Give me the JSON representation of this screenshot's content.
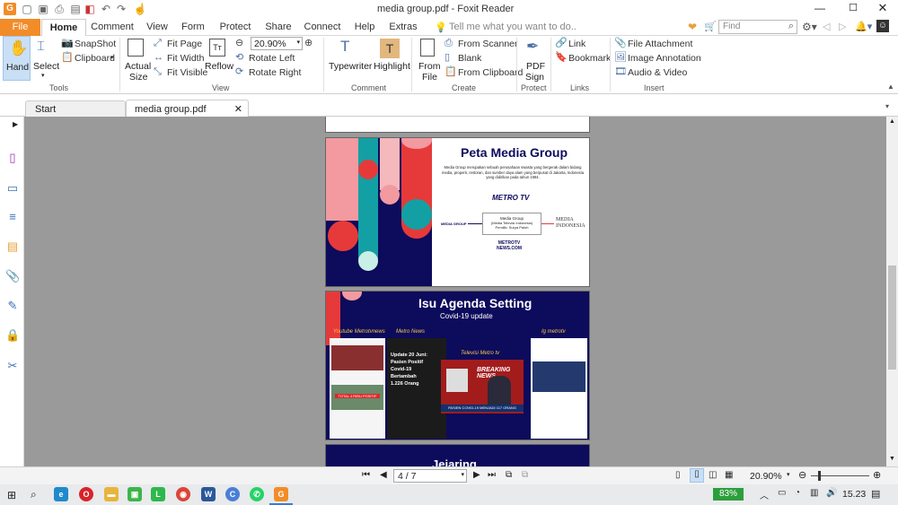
{
  "app": {
    "title": "media group.pdf - Foxit Reader",
    "find_placeholder": "Find",
    "tell_me": "Tell me what you want to do.."
  },
  "menu_tabs": [
    "File",
    "Home",
    "Comment",
    "View",
    "Form",
    "Protect",
    "Share",
    "Connect",
    "Help",
    "Extras"
  ],
  "ribbon": {
    "hand": "Hand",
    "select": "Select",
    "snapshot": "SnapShot",
    "clipboard": "Clipboard",
    "actual_size_1": "Actual",
    "actual_size_2": "Size",
    "fit_page": "Fit Page",
    "fit_width": "Fit Width",
    "fit_visible": "Fit Visible",
    "reflow": "Reflow",
    "zoom_value": "20.90%",
    "rotate_left": "Rotate Left",
    "rotate_right": "Rotate Right",
    "typewriter": "Typewriter",
    "highlight": "Highlight",
    "from_file_1": "From",
    "from_file_2": "File",
    "from_scanner": "From Scanner",
    "blank": "Blank",
    "from_clipboard": "From Clipboard",
    "pdf_sign_1": "PDF",
    "pdf_sign_2": "Sign",
    "link": "Link",
    "bookmark": "Bookmark",
    "file_attachment": "File Attachment",
    "image_annotation": "Image Annotation",
    "audio_video": "Audio & Video",
    "groups": {
      "tools": "Tools",
      "view": "View",
      "comment": "Comment",
      "create": "Create",
      "protect": "Protect",
      "links": "Links",
      "insert": "Insert"
    }
  },
  "doc_tabs": {
    "start": "Start",
    "current": "media group.pdf"
  },
  "slide1": {
    "title": "Peta Media Group",
    "body": "Media Group merupakan sebuah perusahaan swasta yang bergerak dalam bidang media, properti, restoran, dan sumber daya alam yang berpusat di Jakarta, Indonesia yang didirikan pada tahun 1984.",
    "metrotv": "METRO TV",
    "center_1": "Media Group",
    "center_2": "(Media Televisi Indonesia)",
    "center_3": "Pemilik: Surya Paloh",
    "left_logo": "MEDIA GROUP",
    "right_logo_1": "MEDIA",
    "right_logo_2": "INDONESIA",
    "bottom_logo_1": "METROTV",
    "bottom_logo_2": "NEWS.COM"
  },
  "slide2": {
    "title": "Isu Agenda Setting",
    "subtitle": "Covid-19 update",
    "label_youtube": "Youtube Metrotvnews",
    "label_metro": "Metro News",
    "label_ig": "Ig metrotv",
    "label_tv": "Televisi Metro tv",
    "news_1": "Update 20 Juni:",
    "news_2": "Pasien Positif",
    "news_3": "Covid-19",
    "news_4": "Bertambah",
    "news_5": "1.226 Orang",
    "ticker": "PASIEN COVID-19 MENJADI 117 ORANG",
    "breaking": "BREAKING NEWS",
    "positif": "TOTAL 4 RIBU POSITIF"
  },
  "slide3": {
    "title": "Jejaring"
  },
  "status": {
    "page": "4 / 7",
    "zoom": "20.90%"
  },
  "taskbar": {
    "battery": "83%",
    "time": "15.23"
  },
  "colors": {
    "accent_file": "#f28c28",
    "navy": "#0d0b5c",
    "teal": "#13a0a4",
    "red": "#e63a3a",
    "pink": "#f29aa0"
  }
}
